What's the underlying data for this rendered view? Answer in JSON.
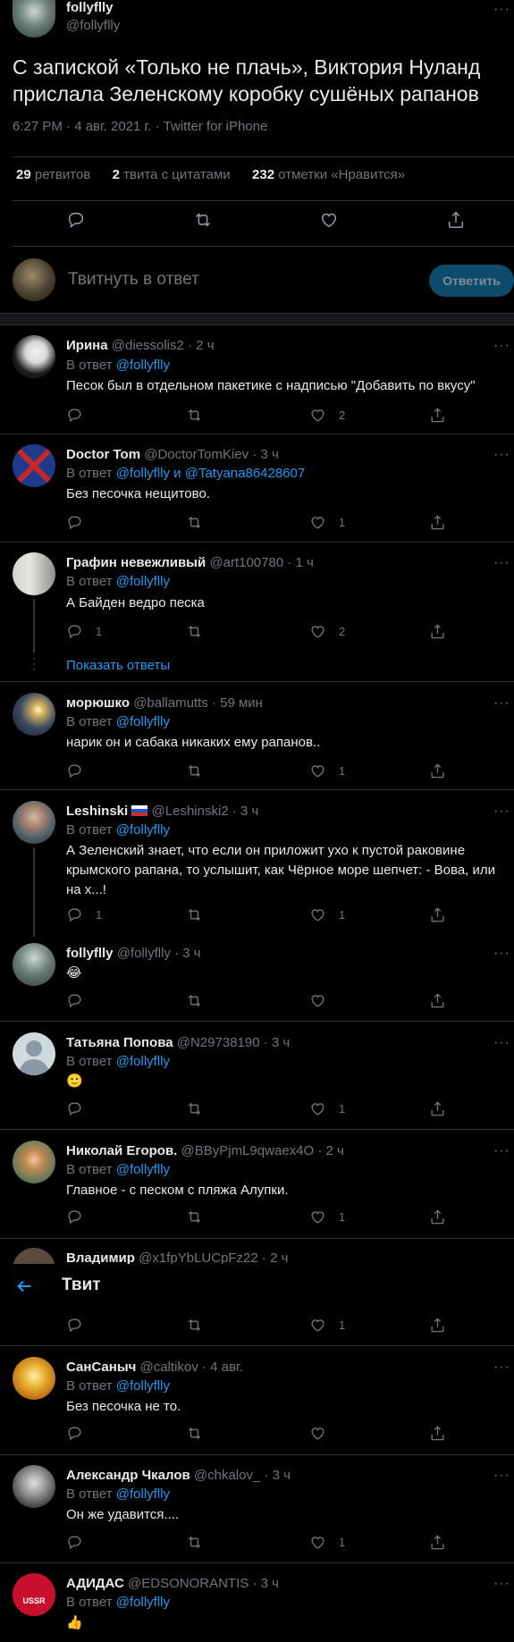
{
  "main_tweet": {
    "display_name": "follyflly",
    "handle": "@follyflly",
    "text": "С запиской «Только не плачь», Виктория Нуланд прислала Зеленскому коробку сушёных рапанов",
    "meta": "6:27 PM · 4 авг. 2021 г. · Twitter for iPhone",
    "stats": {
      "retweets_count": "29",
      "retweets_label": "ретвитов",
      "quotes_count": "2",
      "quotes_label": "твита с цитатами",
      "likes_count": "232",
      "likes_label": "отметки «Нравится»"
    }
  },
  "composer": {
    "placeholder": "Твитнуть в ответ",
    "button": "Ответить"
  },
  "header": {
    "title": "Твит"
  },
  "show_replies": "Показать ответы",
  "replies": [
    {
      "name": "Ирина",
      "handle": "@diessolis2",
      "time": "· 2 ч",
      "reply_to_label": "В ответ",
      "reply_to": "@follyflly",
      "reply_to_2": "",
      "text": "Песок был в отдельном пакетике с надписью \"Добавить по вкусу\"",
      "reply_count": "",
      "like_count": "2"
    },
    {
      "name": "Doctor Tom",
      "handle": "@DoctorTomKiev",
      "time": "· 3 ч",
      "reply_to_label": "В ответ",
      "reply_to": "@follyflly",
      "and": "и",
      "reply_to_2": "@Tatyana86428607",
      "text": "Без песочка нещитово.",
      "reply_count": "",
      "like_count": "1"
    },
    {
      "name": "Графин невежливый",
      "handle": "@art100780",
      "time": "· 1 ч",
      "reply_to_label": "В ответ",
      "reply_to": "@follyflly",
      "reply_to_2": "",
      "text": "А Байден ведро песка",
      "reply_count": "1",
      "like_count": "2"
    },
    {
      "name": "морюшко",
      "handle": "@ballamutts",
      "time": "· 59 мин",
      "reply_to_label": "В ответ",
      "reply_to": "@follyflly",
      "reply_to_2": "",
      "text": "нарик он и сабака никаких ему рапанов..",
      "reply_count": "",
      "like_count": "1"
    },
    {
      "name": "Leshinski",
      "handle": "@Leshinski2",
      "time": "· 3 ч",
      "reply_to_label": "В ответ",
      "reply_to": "@follyflly",
      "reply_to_2": "",
      "text": "А Зеленский знает, что если он приложит ухо к пустой раковине крымского рапана, то  услышит, как Чёрное море шепчет: - Вова, или на х...!",
      "reply_count": "1",
      "like_count": "1"
    },
    {
      "name": "follyflly",
      "handle": "@follyflly",
      "time": "· 3 ч",
      "reply_to_label": "",
      "reply_to": "",
      "reply_to_2": "",
      "text": "😂",
      "reply_count": "",
      "like_count": ""
    },
    {
      "name": "Татьяна Попова",
      "handle": "@N29738190",
      "time": "· 3 ч",
      "reply_to_label": "В ответ",
      "reply_to": "@follyflly",
      "reply_to_2": "",
      "text": "🙂",
      "reply_count": "",
      "like_count": "1"
    },
    {
      "name": "Николай Егоров.",
      "handle": "@BByPjmL9qwaex4O",
      "time": "· 2 ч",
      "reply_to_label": "В ответ",
      "reply_to": "@follyflly",
      "reply_to_2": "",
      "text": "Главное - с песком с пляжа Алупки.",
      "reply_count": "",
      "like_count": "1"
    },
    {
      "name": "Владимир",
      "handle": "@x1fpYbLUCpFz22",
      "time": "· 2 ч",
      "like_count": "1"
    },
    {
      "name": "СанСаныч",
      "handle": "@caltikov",
      "time": "· 4 авг.",
      "reply_to_label": "В ответ",
      "reply_to": "@follyflly",
      "reply_to_2": "",
      "text": "Без песочка не то.",
      "reply_count": "",
      "like_count": ""
    },
    {
      "name": "Александр Чкалов",
      "handle": "@chkalov_",
      "time": "· 3 ч",
      "reply_to_label": "В ответ",
      "reply_to": "@follyflly",
      "reply_to_2": "",
      "text": "Он же удавится....",
      "reply_count": "",
      "like_count": "1"
    },
    {
      "name": "АДИДАС",
      "handle": "@EDSONORANTIS",
      "time": "· 3 ч",
      "reply_to_label": "В ответ",
      "reply_to": "@follyflly",
      "reply_to_2": "",
      "text": "👍",
      "reply_count": "",
      "like_count": ""
    }
  ],
  "icons": [
    "reply-icon",
    "retweet-icon",
    "like-icon",
    "share-icon",
    "back-arrow-icon",
    "more-icon"
  ],
  "colors": {
    "accent": "#1d9bf0",
    "background": "#000000",
    "border": "#2f3336",
    "muted": "#6e767d"
  }
}
